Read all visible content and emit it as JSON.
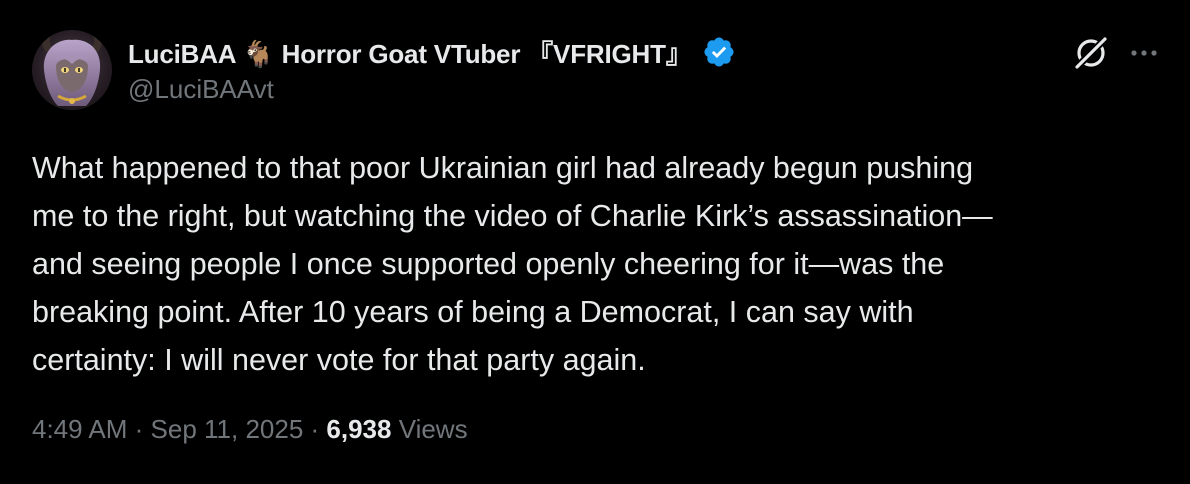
{
  "author": {
    "display_name": "LuciBAA 🐐 Horror Goat VTuber 『VFRIGHT』",
    "handle": "@LuciBAAvt",
    "verified_icon": "verified-badge-icon",
    "avatar_icon": "avatar"
  },
  "actions": {
    "grok_icon": "grok-icon",
    "more_icon": "more-options-icon"
  },
  "tweet": {
    "lines": [
      "What happened to that poor Ukrainian girl had already begun pushing",
      "me to the right, but watching the video of Charlie Kirk’s assassination—",
      "and seeing people I once supported openly cheering for it—was the",
      "breaking point. After 10 years of being a Democrat, I can say with",
      "certainty: I will never vote for that party again."
    ]
  },
  "meta": {
    "time": "4:49 AM",
    "sep1": " · ",
    "date": "Sep 11, 2025",
    "sep2": " · ",
    "views_count": "6,938",
    "views_label": " Views"
  },
  "colors": {
    "background": "#000000",
    "text_primary": "#e7e9ea",
    "text_secondary": "#71767b",
    "verified_blue": "#1d9bf0"
  }
}
